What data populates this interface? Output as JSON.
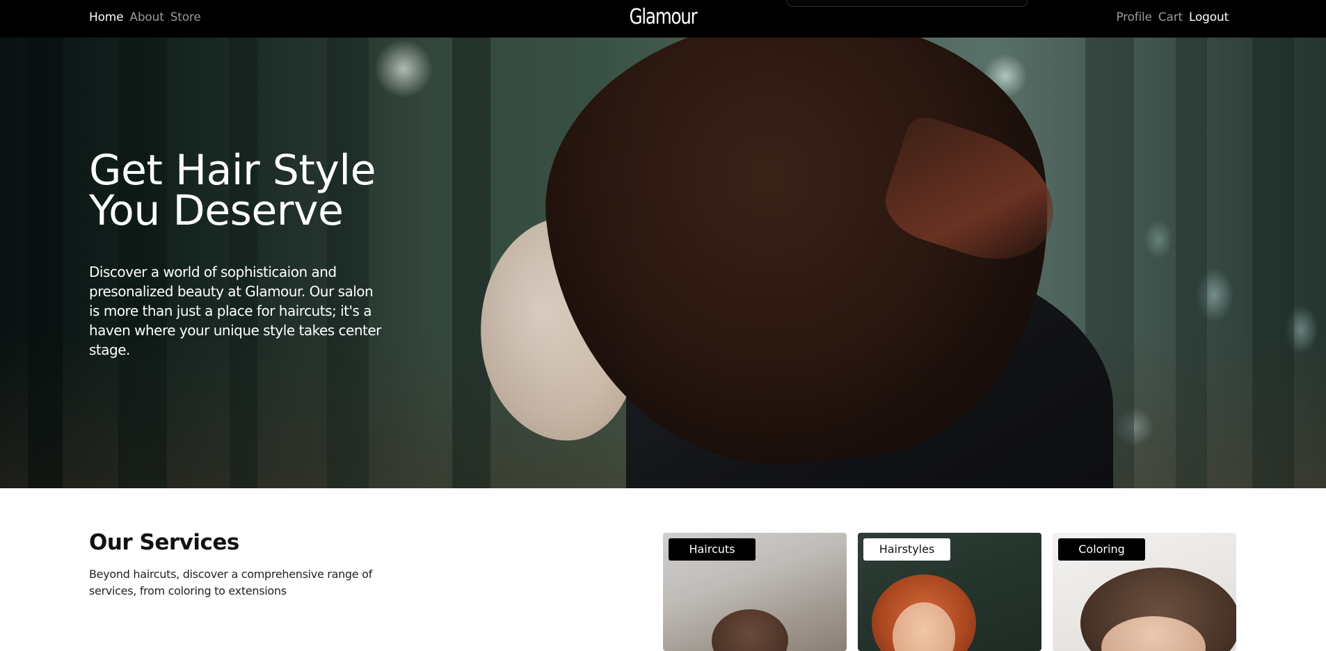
{
  "nav": {
    "left_links": [
      "Home",
      "About",
      "Store"
    ],
    "brand": "Glamour",
    "right_links": [
      "Profile",
      "Cart",
      "Logout"
    ]
  },
  "hero": {
    "title_line1": "Get Hair Style",
    "title_line2": "You Deserve",
    "text": "Discover a world of sophisticaion and presonalized beauty at Glamour. Our salon is more than just a place for haircuts; it's a haven where your unique style takes center stage."
  },
  "services": {
    "title": "Our Services",
    "text": "Beyond haircuts, discover a comprehensive range of services, from coloring to extensions",
    "cards": [
      {
        "label": "Haircuts"
      },
      {
        "label": "Hairstyles"
      },
      {
        "label": "Coloring"
      }
    ]
  },
  "colors": {
    "navbar_bg": "#000000",
    "active_link": "#ffffff",
    "inactive_link": "#9a9a9a"
  }
}
